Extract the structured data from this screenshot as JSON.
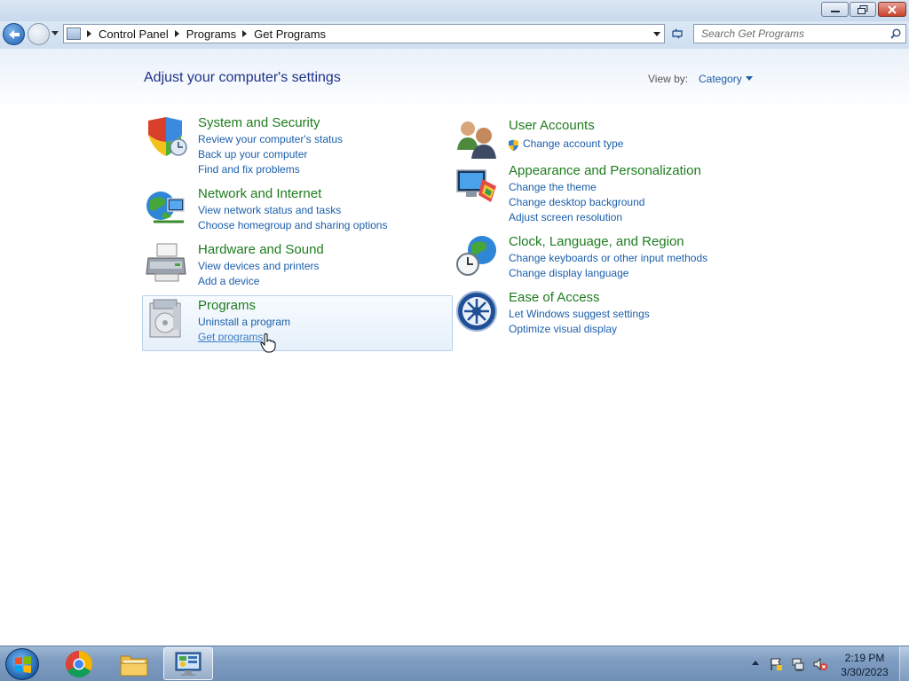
{
  "window": {
    "controls": [
      "minimize",
      "maximize",
      "close"
    ]
  },
  "address": {
    "breadcrumbs": [
      "Control Panel",
      "Programs",
      "Get Programs"
    ]
  },
  "search": {
    "placeholder": "Search Get Programs"
  },
  "header": {
    "title": "Adjust your computer's settings",
    "view_by_label": "View by:",
    "view_by_value": "Category"
  },
  "categories": [
    {
      "title": "System and Security",
      "icon": "shield-icon",
      "links": [
        "Review your computer's status",
        "Back up your computer",
        "Find and fix problems"
      ]
    },
    {
      "title": "Network and Internet",
      "icon": "globe-network-icon",
      "links": [
        "View network status and tasks",
        "Choose homegroup and sharing options"
      ]
    },
    {
      "title": "Hardware and Sound",
      "icon": "printer-icon",
      "links": [
        "View devices and printers",
        "Add a device"
      ]
    },
    {
      "title": "Programs",
      "icon": "programs-icon",
      "links": [
        "Uninstall a program",
        "Get programs"
      ],
      "highlighted": true
    },
    {
      "title": "User Accounts",
      "icon": "users-icon",
      "links": [
        "Change account type"
      ]
    },
    {
      "title": "Appearance and Personalization",
      "icon": "monitor-paint-icon",
      "links": [
        "Change the theme",
        "Change desktop background",
        "Adjust screen resolution"
      ]
    },
    {
      "title": "Clock, Language, and Region",
      "icon": "clock-globe-icon",
      "links": [
        "Change keyboards or other input methods",
        "Change display language"
      ]
    },
    {
      "title": "Ease of Access",
      "icon": "ease-of-access-icon",
      "links": [
        "Let Windows suggest settings",
        "Optimize visual display"
      ]
    }
  ],
  "taskbar": {
    "items": [
      "start-button",
      "chrome-icon",
      "explorer-icon",
      "control-panel-icon"
    ],
    "active": "control-panel-icon",
    "clock_time": "2:19 PM",
    "clock_date": "3/30/2023"
  },
  "colors": {
    "category_title": "#1e7c1e",
    "link": "#1b5fab",
    "page_title": "#1e3287"
  }
}
